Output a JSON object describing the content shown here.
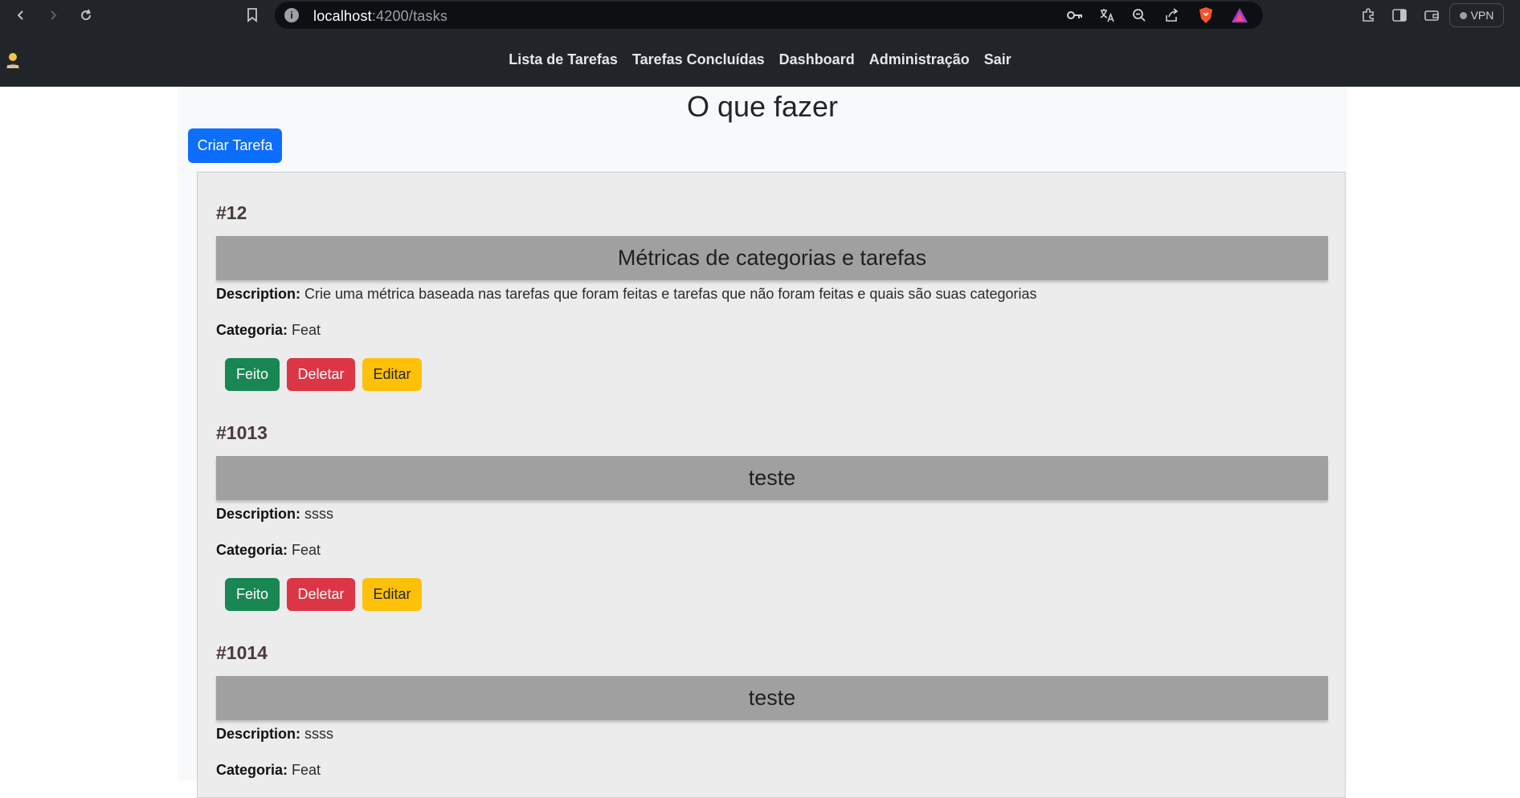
{
  "browser": {
    "url_host": "localhost",
    "url_path": ":4200/tasks",
    "vpn_label": "VPN"
  },
  "nav": {
    "links": [
      "Lista de Tarefas",
      "Tarefas Concluídas",
      "Dashboard",
      "Administração",
      "Sair"
    ]
  },
  "page": {
    "title": "O que fazer",
    "create_button": "Criar Tarefa"
  },
  "labels": {
    "description": "Description:",
    "category": "Categoria:"
  },
  "actions": {
    "done": "Feito",
    "delete": "Deletar",
    "edit": "Editar"
  },
  "tasks": [
    {
      "id": "#12",
      "title": "Métricas de categorias e tarefas",
      "description": "Crie uma métrica baseada nas tarefas que foram feitas e tarefas que não foram feitas e quais são suas categorias",
      "category": "Feat"
    },
    {
      "id": "#1013",
      "title": "teste",
      "description": "ssss",
      "category": "Feat"
    },
    {
      "id": "#1014",
      "title": "teste",
      "description": "ssss",
      "category": "Feat"
    }
  ],
  "colors": {
    "navbar": "#212529",
    "primary": "#0d6efd",
    "success": "#198754",
    "danger": "#dc3545",
    "warning": "#ffc107"
  }
}
